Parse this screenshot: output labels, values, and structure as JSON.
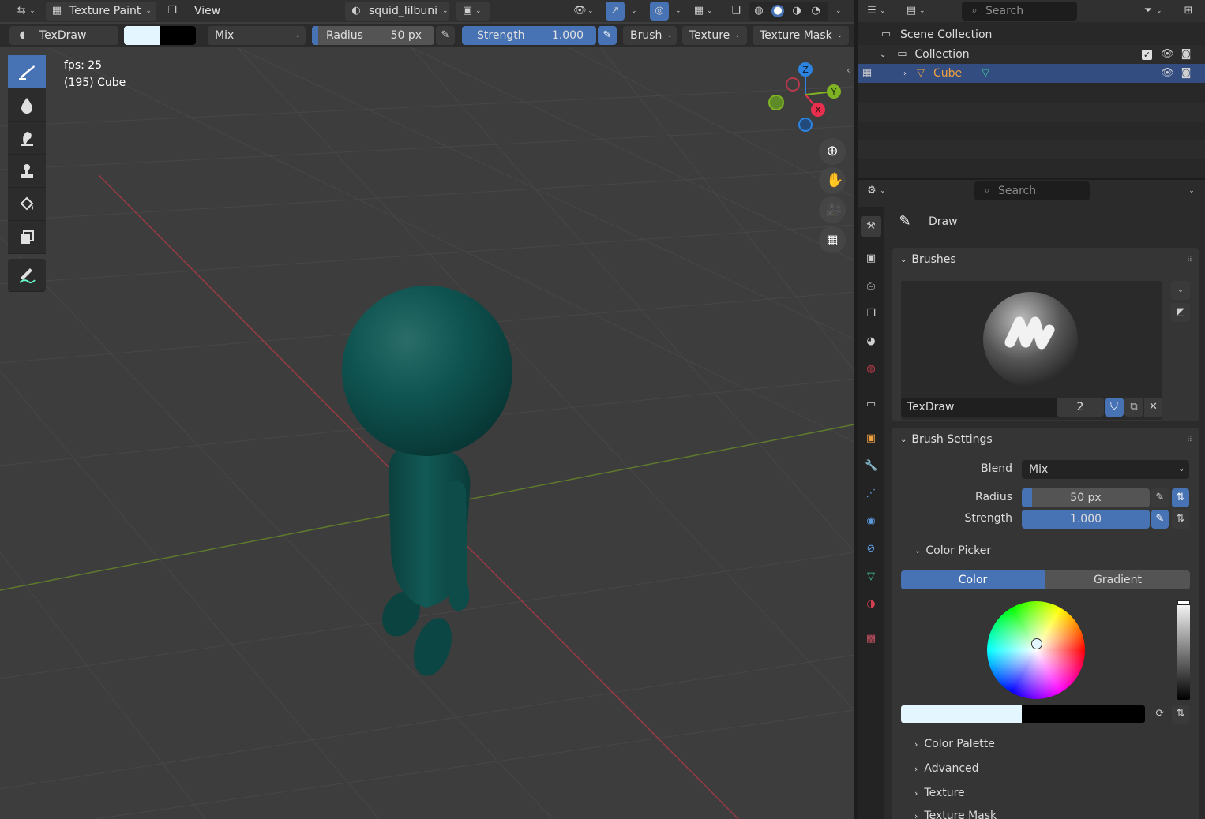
{
  "header": {
    "mode_label": "Texture Paint",
    "view_label": "View",
    "image_name": "squid_lilbuni"
  },
  "tool_settings": {
    "brush_name": "TexDraw",
    "blend": "Mix",
    "radius_label": "Radius",
    "radius_value": "50 px",
    "strength_label": "Strength",
    "strength_value": "1.000",
    "brush_menu": "Brush",
    "texture_menu": "Texture",
    "texture_mask_menu": "Texture Mask"
  },
  "viewport": {
    "fps_text": "fps: 25",
    "object_text": "(195) Cube",
    "gizmo": {
      "x": "X",
      "y": "Y",
      "z": "Z"
    }
  },
  "outliner": {
    "search_placeholder": "Search",
    "scene_collection": "Scene Collection",
    "collection": "Collection",
    "object": "Cube"
  },
  "properties": {
    "search_placeholder": "Search",
    "tool_name": "Draw",
    "brushes_header": "Brushes",
    "brush_name": "TexDraw",
    "brush_users": "2",
    "brush_settings_header": "Brush Settings",
    "blend_label": "Blend",
    "blend_value": "Mix",
    "radius_label": "Radius",
    "radius_value": "50 px",
    "strength_label": "Strength",
    "strength_value": "1.000",
    "color_picker_header": "Color Picker",
    "color_tab": "Color",
    "gradient_tab": "Gradient",
    "collapsed_panels": [
      "Color Palette",
      "Advanced",
      "Texture",
      "Texture Mask"
    ]
  },
  "colors": {
    "accent": "#4772b3",
    "primary_color": "#e4f6ff",
    "secondary_color": "#000000",
    "object_teal": "#0f4e4b",
    "axis_x": "#e8304e",
    "axis_y": "#7fb324",
    "axis_z": "#2c84e0"
  }
}
